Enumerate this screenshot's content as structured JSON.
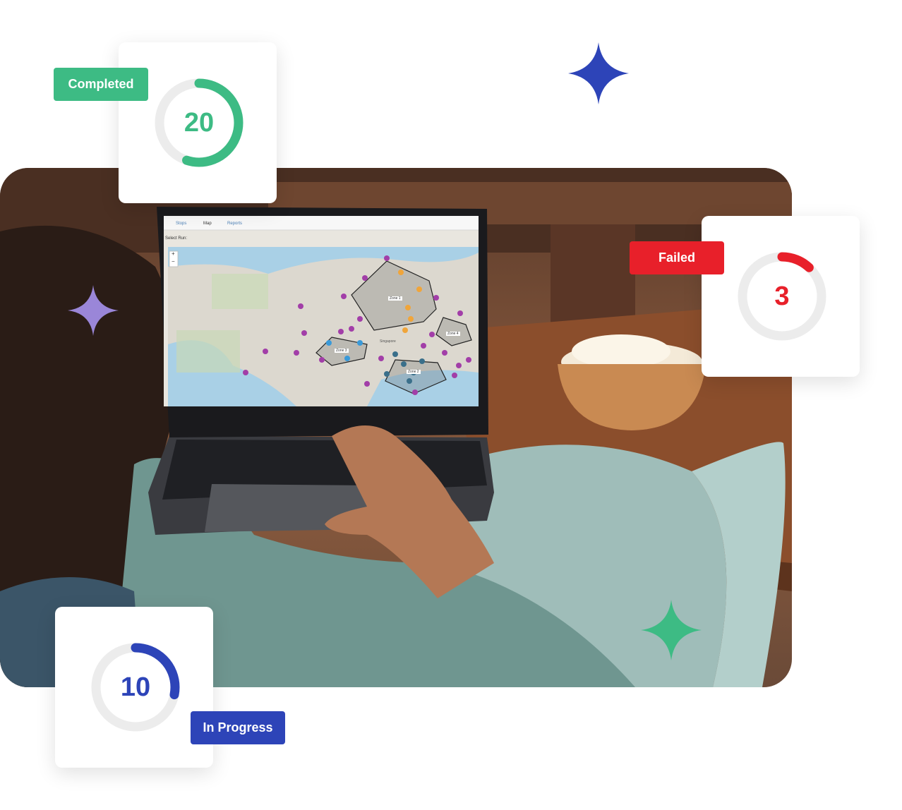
{
  "laptop_ui": {
    "tabs": [
      {
        "label": "Stops"
      },
      {
        "label": "Map"
      },
      {
        "label": "Reports"
      }
    ],
    "select_run_label": "Select Run:",
    "map": {
      "zoom_in": "+",
      "zoom_out": "−",
      "zones": [
        {
          "label": "Zone 1"
        },
        {
          "label": "Zone 2"
        },
        {
          "label": "Zone 3"
        },
        {
          "label": "Zone 4"
        }
      ],
      "city_label": "Singapore"
    }
  },
  "status_cards": {
    "completed": {
      "label": "Completed",
      "count": "20",
      "progress": 0.55,
      "color": "#3dbb84"
    },
    "failed": {
      "label": "Failed",
      "count": "3",
      "progress": 0.12,
      "color": "#e8202a"
    },
    "in_progress": {
      "label": "In Progress",
      "count": "10",
      "progress": 0.28,
      "color": "#2d44b8"
    }
  },
  "colors": {
    "sparkle_blue": "#2d44b8",
    "sparkle_purple": "#9a86d8",
    "sparkle_green": "#3dbb84",
    "ring_track": "#ececec"
  }
}
